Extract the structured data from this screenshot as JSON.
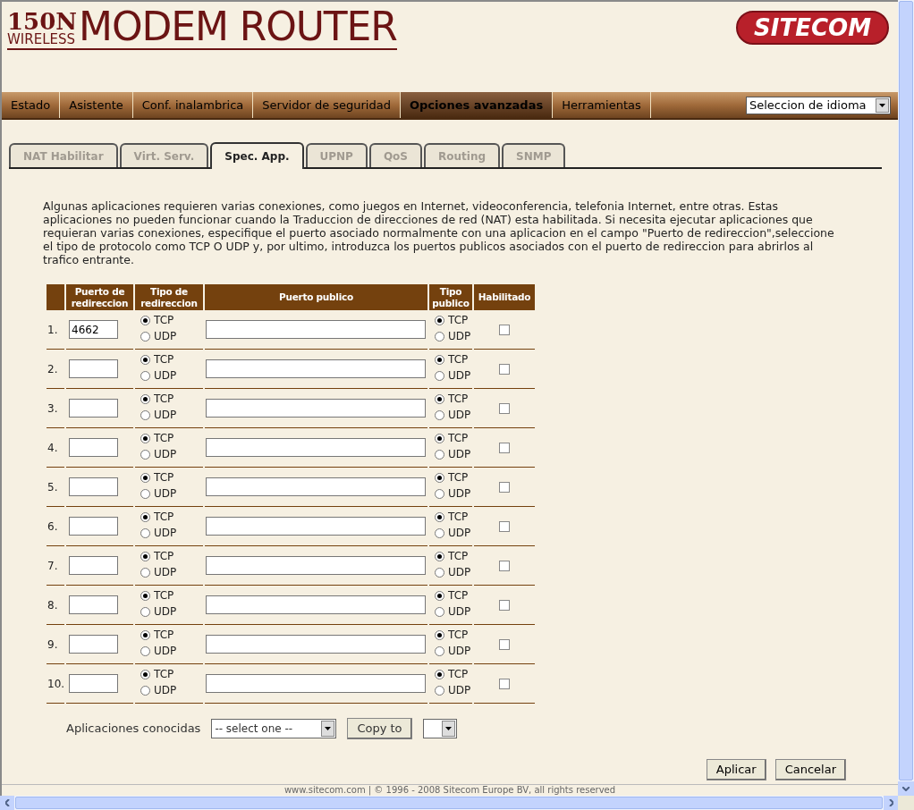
{
  "header": {
    "capacity": "150N",
    "wireless": "WIRELESS",
    "title": "MODEM ROUTER",
    "brand": "SITECOM"
  },
  "nav": [
    {
      "label": "Estado",
      "selected": false
    },
    {
      "label": "Asistente",
      "selected": false
    },
    {
      "label": "Conf. inalambrica",
      "selected": false
    },
    {
      "label": "Servidor de seguridad",
      "selected": false
    },
    {
      "label": "Opciones avanzadas",
      "selected": true
    },
    {
      "label": "Herramientas",
      "selected": false
    }
  ],
  "language_select": {
    "value": "Seleccion de idioma"
  },
  "tabs": [
    {
      "label": "NAT Habilitar",
      "selected": false
    },
    {
      "label": "Virt. Serv.",
      "selected": false
    },
    {
      "label": "Spec. App.",
      "selected": true
    },
    {
      "label": "UPNP",
      "selected": false
    },
    {
      "label": "QoS",
      "selected": false
    },
    {
      "label": "Routing",
      "selected": false
    },
    {
      "label": "SNMP",
      "selected": false
    }
  ],
  "description": "Algunas aplicaciones requieren varias conexiones, como juegos en Internet, videoconferencia, telefonia Internet, entre otras. Estas aplicaciones no pueden funcionar cuando la Traduccion de direcciones de red (NAT) esta habilitada. Si necesita ejecutar aplicaciones que requieran varias conexiones, especifique el puerto asociado normalmente con una aplicacion en el campo \"Puerto de redireccion\",seleccione el tipo de protocolo como TCP O UDP y, por ultimo, introduzca los puertos publicos asociados con el puerto de redireccion para abrirlos al trafico entrante.",
  "table": {
    "columns": [
      "Puerto de redireccion",
      "Tipo de redireccion",
      "Puerto publico",
      "Tipo publico",
      "Habilitado"
    ],
    "rows": [
      {
        "number": "1.",
        "redirect_port": "4662",
        "redirect_type": [
          {
            "label": "TCP",
            "selected": true
          },
          {
            "label": "UDP",
            "selected": false
          }
        ],
        "public_type": [
          {
            "label": "TCP",
            "selected": true
          },
          {
            "label": "UDP",
            "selected": false
          }
        ],
        "enabled": false
      },
      {
        "number": "2.",
        "redirect_type": [
          {
            "label": "TCP",
            "selected": true
          },
          {
            "label": "UDP",
            "selected": false
          }
        ],
        "public_type": [
          {
            "label": "TCP",
            "selected": true
          },
          {
            "label": "UDP",
            "selected": false
          }
        ],
        "enabled": false
      },
      {
        "number": "3.",
        "redirect_type": [
          {
            "label": "TCP",
            "selected": true
          },
          {
            "label": "UDP",
            "selected": false
          }
        ],
        "public_type": [
          {
            "label": "TCP",
            "selected": true
          },
          {
            "label": "UDP",
            "selected": false
          }
        ],
        "enabled": false
      },
      {
        "number": "4.",
        "redirect_type": [
          {
            "label": "TCP",
            "selected": true
          },
          {
            "label": "UDP",
            "selected": false
          }
        ],
        "public_type": [
          {
            "label": "TCP",
            "selected": true
          },
          {
            "label": "UDP",
            "selected": false
          }
        ],
        "enabled": false
      },
      {
        "number": "5.",
        "redirect_type": [
          {
            "label": "TCP",
            "selected": true
          },
          {
            "label": "UDP",
            "selected": false
          }
        ],
        "public_type": [
          {
            "label": "TCP",
            "selected": true
          },
          {
            "label": "UDP",
            "selected": false
          }
        ],
        "enabled": false
      },
      {
        "number": "6.",
        "redirect_type": [
          {
            "label": "TCP",
            "selected": true
          },
          {
            "label": "UDP",
            "selected": false
          }
        ],
        "public_type": [
          {
            "label": "TCP",
            "selected": true
          },
          {
            "label": "UDP",
            "selected": false
          }
        ],
        "enabled": false
      },
      {
        "number": "7.",
        "redirect_type": [
          {
            "label": "TCP",
            "selected": true
          },
          {
            "label": "UDP",
            "selected": false
          }
        ],
        "public_type": [
          {
            "label": "TCP",
            "selected": true
          },
          {
            "label": "UDP",
            "selected": false
          }
        ],
        "enabled": false
      },
      {
        "number": "8.",
        "redirect_type": [
          {
            "label": "TCP",
            "selected": true
          },
          {
            "label": "UDP",
            "selected": false
          }
        ],
        "public_type": [
          {
            "label": "TCP",
            "selected": true
          },
          {
            "label": "UDP",
            "selected": false
          }
        ],
        "enabled": false
      },
      {
        "number": "9.",
        "redirect_type": [
          {
            "label": "TCP",
            "selected": true
          },
          {
            "label": "UDP",
            "selected": false
          }
        ],
        "public_type": [
          {
            "label": "TCP",
            "selected": true
          },
          {
            "label": "UDP",
            "selected": false
          }
        ],
        "enabled": false
      },
      {
        "number": "10.",
        "redirect_type": [
          {
            "label": "TCP",
            "selected": true
          },
          {
            "label": "UDP",
            "selected": false
          }
        ],
        "public_type": [
          {
            "label": "TCP",
            "selected": true
          },
          {
            "label": "UDP",
            "selected": false
          }
        ],
        "enabled": false
      }
    ]
  },
  "known_apps": {
    "label": "Aplicaciones conocidas",
    "select_value": "-- select one --",
    "copy_button": "Copy to"
  },
  "buttons": [
    "Aplicar",
    "Cancelar"
  ],
  "footer": "www.sitecom.com | © 1996 - 2008 Sitecom Europe BV, all rights reserved"
}
